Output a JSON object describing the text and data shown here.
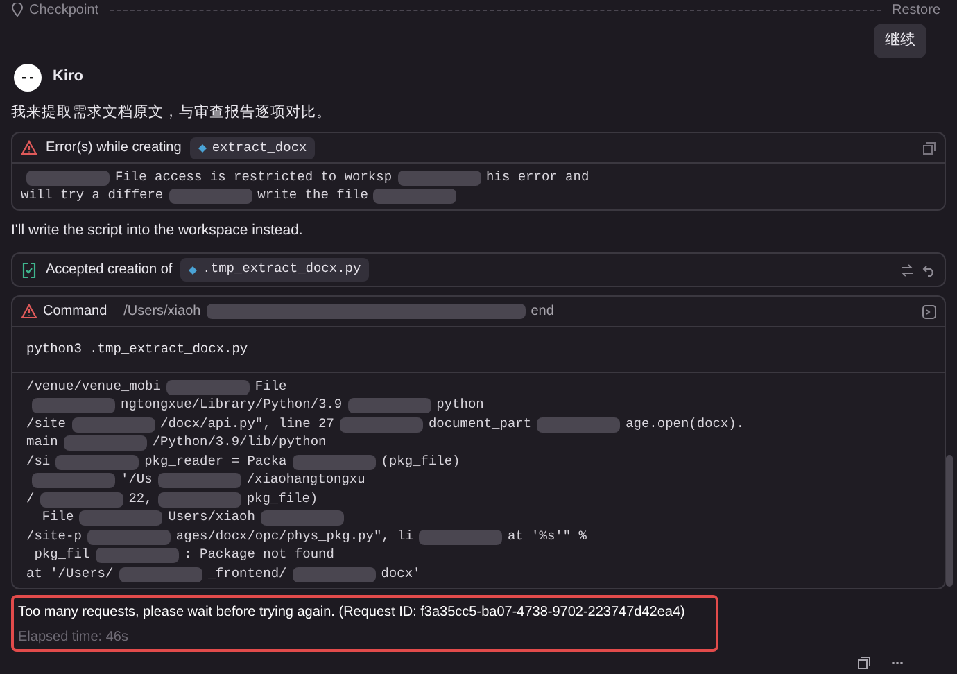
{
  "checkpoint": {
    "label": "Checkpoint",
    "restore": "Restore"
  },
  "continue_button": "继续",
  "agent": {
    "name": "Kiro"
  },
  "intro": "我来提取需求文档原文，与审查报告逐项对比。",
  "error_card": {
    "title": "Error(s) while creating",
    "file": "extract_docx",
    "lines": [
      [
        {
          "kind": "redacted"
        },
        {
          "kind": "text",
          "text": "File access is restricted to worksp"
        },
        {
          "kind": "redacted"
        },
        {
          "kind": "text",
          "text": "his error and"
        }
      ],
      [
        {
          "kind": "text",
          "text": "will try a differe"
        },
        {
          "kind": "redacted"
        },
        {
          "kind": "text",
          "text": "write the file"
        },
        {
          "kind": "redacted"
        }
      ]
    ]
  },
  "note": "I'll write the script into the workspace instead.",
  "accepted_card": {
    "title": "Accepted creation of",
    "file": ".tmp_extract_docx.py"
  },
  "command_card": {
    "title": "Command",
    "path_start": "/Users/xiaoh",
    "path_end": "end",
    "command": "python3 .tmp_extract_docx.py",
    "output": [
      [
        {
          "kind": "text",
          "text": "/venue/venue_mobi"
        },
        {
          "kind": "redacted"
        },
        {
          "kind": "text",
          "text": "File"
        }
      ],
      [
        {
          "kind": "redacted"
        },
        {
          "kind": "text",
          "text": "ngtongxue/Library/Python/3.9"
        },
        {
          "kind": "redacted"
        },
        {
          "kind": "text",
          "text": "python"
        }
      ],
      [
        {
          "kind": "text",
          "text": "/site"
        },
        {
          "kind": "redacted"
        },
        {
          "kind": "text",
          "text": "/docx/api.py\", line 27"
        },
        {
          "kind": "redacted"
        },
        {
          "kind": "text",
          "text": "document_part"
        },
        {
          "kind": "redacted"
        },
        {
          "kind": "text",
          "text": "age.open(docx)."
        }
      ],
      [
        {
          "kind": "text",
          "text": "main"
        },
        {
          "kind": "redacted"
        },
        {
          "kind": "text",
          "text": "/Python/3.9/lib/python"
        }
      ],
      [
        {
          "kind": "text",
          "text": "/si"
        },
        {
          "kind": "redacted"
        },
        {
          "kind": "text",
          "text": "pkg_reader = Packa"
        },
        {
          "kind": "redacted"
        },
        {
          "kind": "text",
          "text": "(pkg_file)"
        }
      ],
      [
        {
          "kind": "redacted"
        },
        {
          "kind": "text",
          "text": "'/Us"
        },
        {
          "kind": "redacted"
        },
        {
          "kind": "text",
          "text": "/xiaohangtongxu"
        }
      ],
      [
        {
          "kind": "text",
          "text": "/"
        },
        {
          "kind": "redacted"
        },
        {
          "kind": "text",
          "text": "22,"
        },
        {
          "kind": "redacted"
        },
        {
          "kind": "text",
          "text": "pkg_file)"
        }
      ],
      [
        {
          "kind": "text",
          "text": "  File"
        },
        {
          "kind": "redacted"
        },
        {
          "kind": "text",
          "text": "Users/xiaoh"
        },
        {
          "kind": "redacted"
        }
      ],
      [
        {
          "kind": "text",
          "text": "/site-p"
        },
        {
          "kind": "redacted"
        },
        {
          "kind": "text",
          "text": "ages/docx/opc/phys_pkg.py\", li"
        },
        {
          "kind": "redacted"
        },
        {
          "kind": "text",
          "text": "at '%s'\" %"
        }
      ],
      [
        {
          "kind": "text",
          "text": " pkg_fil"
        },
        {
          "kind": "redacted"
        },
        {
          "kind": "text",
          "text": ": Package not found"
        }
      ],
      [
        {
          "kind": "text",
          "text": "at '/Users/"
        },
        {
          "kind": "redacted"
        },
        {
          "kind": "text",
          "text": "_frontend/"
        },
        {
          "kind": "redacted"
        },
        {
          "kind": "text",
          "text": "docx'"
        }
      ]
    ]
  },
  "request_error": "Too many requests, please wait before trying again. (Request ID: f3a35cc5-ba07-4738-9702-223747d42ea4)",
  "elapsed": "Elapsed time: 46s"
}
